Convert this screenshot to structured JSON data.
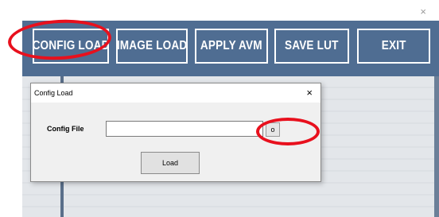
{
  "window": {
    "close_glyph": "×"
  },
  "toolbar": {
    "buttons": [
      {
        "label": "CONFIG LOAD"
      },
      {
        "label": "IMAGE LOAD"
      },
      {
        "label": "APPLY AVM"
      },
      {
        "label": "SAVE LUT"
      },
      {
        "label": "EXIT"
      }
    ]
  },
  "dialog": {
    "title": "Config Load",
    "close_glyph": "×",
    "config_file_label": "Config File",
    "config_file_value": "",
    "browse_label": "o",
    "load_label": "Load"
  },
  "colors": {
    "toolbar_bg": "#4f6d92",
    "annotation": "#e8101d"
  }
}
